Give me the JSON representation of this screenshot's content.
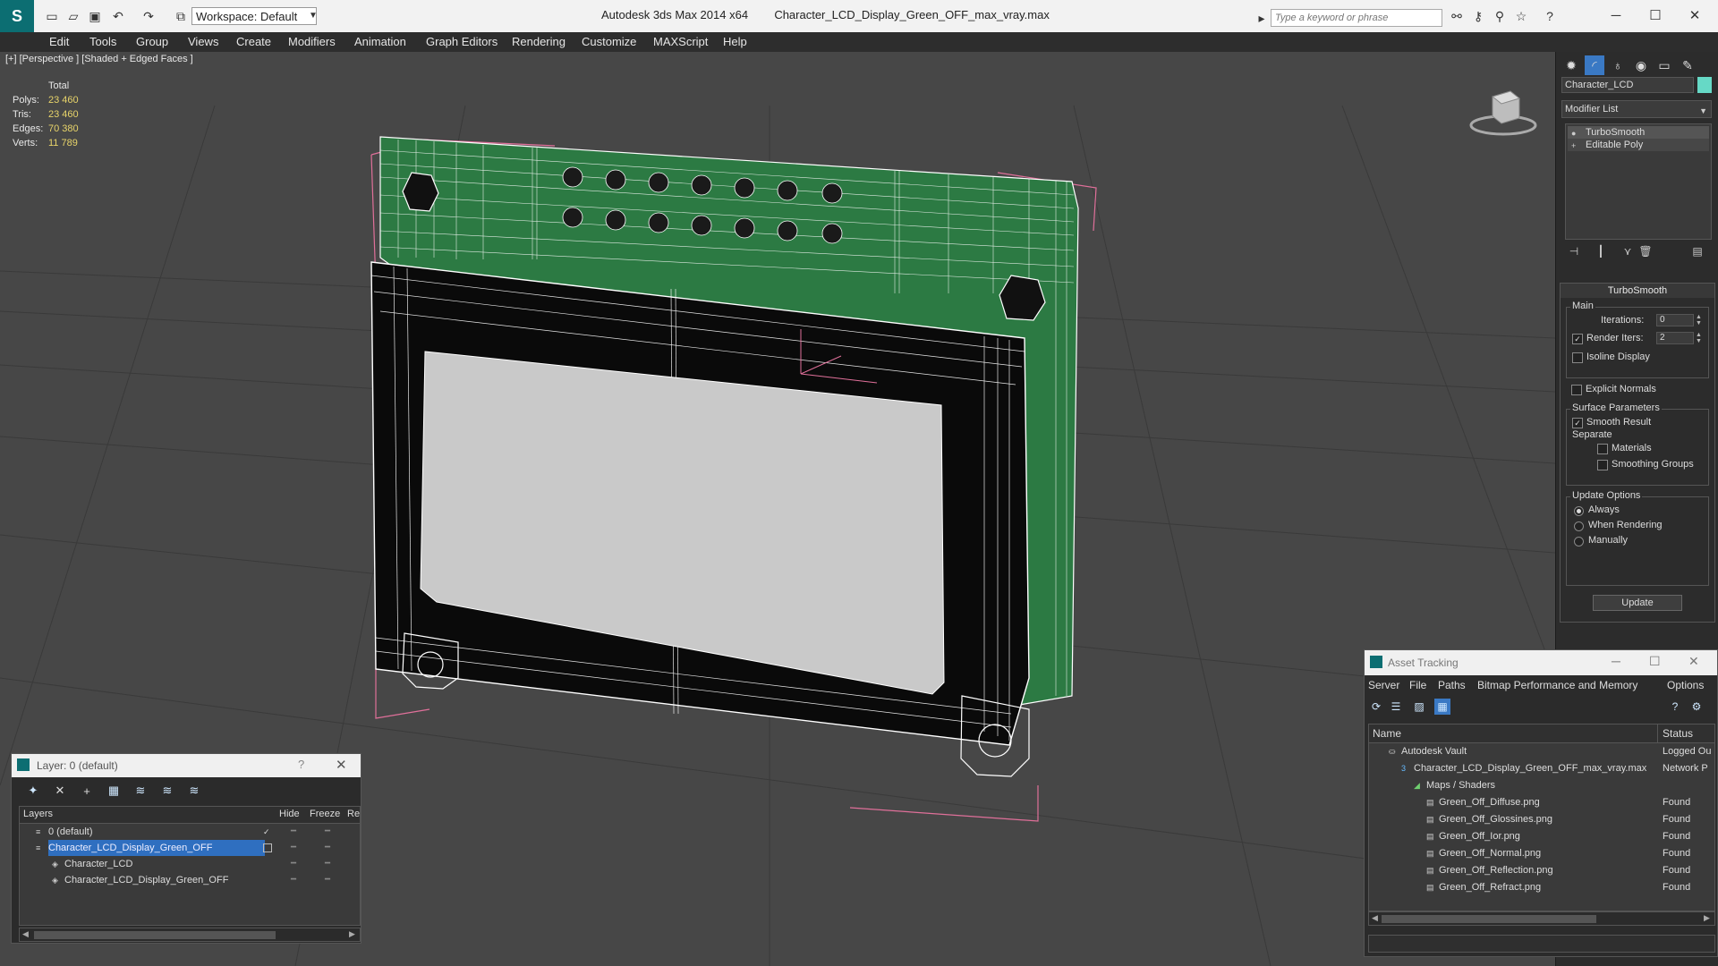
{
  "window": {
    "app_title": "Autodesk 3ds Max  2014 x64",
    "file_title": "Character_LCD_Display_Green_OFF_max_vray.max",
    "workspace": "Workspace: Default",
    "search_placeholder": "Type a keyword or phrase",
    "logo_glyph": "S"
  },
  "menu": [
    "Edit",
    "Tools",
    "Group",
    "Views",
    "Create",
    "Modifiers",
    "Animation",
    "Graph Editors",
    "Rendering",
    "Customize",
    "MAXScript",
    "Help"
  ],
  "viewport": {
    "label": "[+] [Perspective ] [Shaded + Edged Faces ]",
    "stats_header": "Total",
    "stats": [
      {
        "key": "Polys:",
        "value": "23 460"
      },
      {
        "key": "Tris:",
        "value": "23 460"
      },
      {
        "key": "Edges:",
        "value": "70 380"
      },
      {
        "key": "Verts:",
        "value": "11 789"
      }
    ],
    "colors": {
      "pcb": "#2c7a43",
      "frame": "#0a0a0a",
      "screen": "#c9c9c9",
      "wire": "#ffffff",
      "bbox": "#e0709a"
    }
  },
  "command_panel": {
    "object_name": "Character_LCD",
    "object_color": "#66d9c6",
    "modifier_list": "Modifier List",
    "stack": [
      "TurboSmooth",
      "Editable Poly"
    ],
    "turbosmooth": {
      "title": "TurboSmooth",
      "main": "Main",
      "iterations_label": "Iterations:",
      "iterations": "0",
      "render_iters_label": "Render Iters:",
      "render_iters": "2",
      "isoline": "Isoline Display",
      "explicit": "Explicit Normals",
      "surface": "Surface Parameters",
      "smooth_result": "Smooth Result",
      "separate": "Separate",
      "materials": "Materials",
      "smoothing_groups": "Smoothing Groups",
      "update_options": "Update Options",
      "always": "Always",
      "when_rendering": "When Rendering",
      "manually": "Manually",
      "update": "Update"
    }
  },
  "layer_dialog": {
    "title": "Layer: 0 (default)",
    "help": "?",
    "columns": {
      "layers": "Layers",
      "hide": "Hide",
      "freeze": "Freeze",
      "render": "Re"
    },
    "rows": [
      {
        "name": "0 (default)",
        "indent": 0,
        "selected": false,
        "current": true
      },
      {
        "name": "Character_LCD_Display_Green_OFF",
        "indent": 0,
        "selected": true,
        "current": false
      },
      {
        "name": "Character_LCD",
        "indent": 1,
        "selected": false,
        "current": false
      },
      {
        "name": "Character_LCD_Display_Green_OFF",
        "indent": 1,
        "selected": false,
        "current": false
      }
    ]
  },
  "asset_dialog": {
    "title": "Asset Tracking",
    "menus": [
      "Server",
      "File",
      "Paths",
      "Bitmap Performance and Memory",
      "Options"
    ],
    "columns": {
      "name": "Name",
      "status": "Status"
    },
    "rows": [
      {
        "name": "Autodesk Vault",
        "status": "Logged Ou",
        "indent": 0
      },
      {
        "name": "Character_LCD_Display_Green_OFF_max_vray.max",
        "status": "Network P",
        "indent": 1
      },
      {
        "name": "Maps / Shaders",
        "status": "",
        "indent": 2
      },
      {
        "name": "Green_Off_Diffuse.png",
        "status": "Found",
        "indent": 3
      },
      {
        "name": "Green_Off_Glossines.png",
        "status": "Found",
        "indent": 3
      },
      {
        "name": "Green_Off_Ior.png",
        "status": "Found",
        "indent": 3
      },
      {
        "name": "Green_Off_Normal.png",
        "status": "Found",
        "indent": 3
      },
      {
        "name": "Green_Off_Reflection.png",
        "status": "Found",
        "indent": 3
      },
      {
        "name": "Green_Off_Refract.png",
        "status": "Found",
        "indent": 3
      }
    ]
  }
}
